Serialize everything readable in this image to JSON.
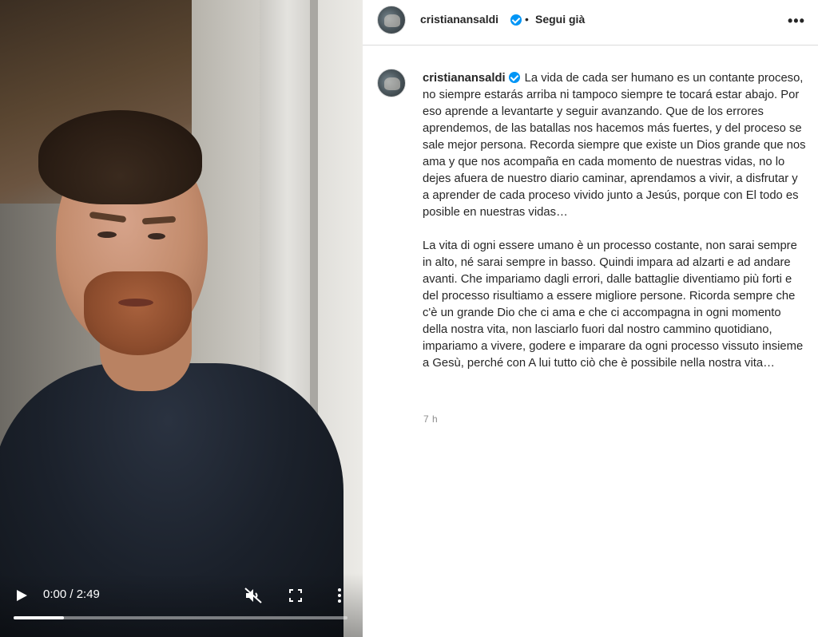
{
  "video": {
    "time_display": "0:00 / 2:49",
    "progress_fraction": 0.15
  },
  "post_header": {
    "username": "cristianansaldi",
    "separator": "•",
    "follow_status": "Segui già",
    "options_icon": "more-horizontal-icon"
  },
  "caption": {
    "username": "cristianansaldi",
    "text": "La vida de cada ser humano es un contante proceso, no siempre estarás arriba ni tampoco siempre te tocará estar abajo. Por eso aprende a levantarte y seguir avanzando. Que de los errores aprendemos, de las batallas nos hacemos más fuertes, y del proceso se sale mejor persona. Recorda siempre que existe un Dios grande que nos ama y que nos acompaña en cada momento de nuestras vidas, no lo dejes afuera de nuestro diario caminar, aprendamos a vivir, a disfrutar y a aprender de cada proceso vivido junto a Jesús, porque con El todo es posible en nuestras vidas…\n\nLa vita di ogni essere umano è un processo costante, non sarai sempre in alto, né sarai sempre in basso. Quindi impara ad alzarti e ad andare avanti. Che impariamo dagli errori, dalle battaglie diventiamo più forti e del processo risultiamo a essere migliore persone. Ricorda sempre che c'è un grande Dio che ci ama e che ci accompagna in ogni momento della nostra vita, non lasciarlo fuori dal nostro cammino quotidiano, impariamo a vivere, godere e imparare da ogni processo vissuto insieme a Gesù, perché con A lui tutto ciò che è possibile nella nostra vita…",
    "timestamp": "7 h"
  },
  "colors": {
    "verified": "#0095f6",
    "text": "#262626",
    "muted": "#8e8e8e",
    "border": "#dbdbdb"
  }
}
